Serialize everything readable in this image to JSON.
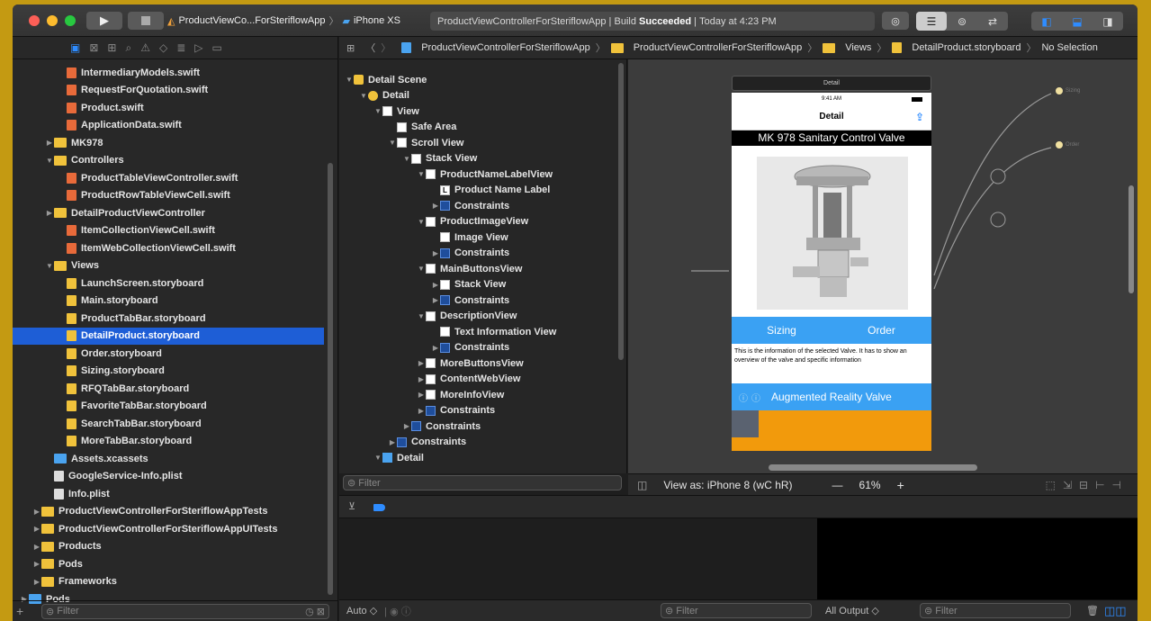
{
  "toolbar": {
    "scheme": "ProductViewCo...ForSteriflowApp",
    "device": "iPhone XS",
    "status_project": "ProductViewControllerForSteriflowApp",
    "status_build": "Build",
    "status_result": "Succeeded",
    "status_time": "Today at 4:23 PM"
  },
  "navigator": {
    "items": [
      {
        "label": "IntermediaryModels.swift",
        "kind": "swift",
        "indent": 2
      },
      {
        "label": "RequestForQuotation.swift",
        "kind": "swift",
        "indent": 2
      },
      {
        "label": "Product.swift",
        "kind": "swift",
        "indent": 2
      },
      {
        "label": "ApplicationData.swift",
        "kind": "swift",
        "indent": 2
      },
      {
        "label": "MK978",
        "kind": "folder",
        "indent": 1,
        "disclosure": "closed"
      },
      {
        "label": "Controllers",
        "kind": "folder",
        "indent": 1,
        "disclosure": "open"
      },
      {
        "label": "ProductTableViewController.swift",
        "kind": "swift",
        "indent": 2
      },
      {
        "label": "ProductRowTableViewCell.swift",
        "kind": "swift",
        "indent": 2
      },
      {
        "label": "DetailProductViewController",
        "kind": "folder",
        "indent": 1,
        "disclosure": "closed"
      },
      {
        "label": "ItemCollectionViewCell.swift",
        "kind": "swift",
        "indent": 2
      },
      {
        "label": "ItemWebCollectionViewCell.swift",
        "kind": "swift",
        "indent": 2
      },
      {
        "label": "Views",
        "kind": "folder",
        "indent": 1,
        "disclosure": "open"
      },
      {
        "label": "LaunchScreen.storyboard",
        "kind": "sb",
        "indent": 2
      },
      {
        "label": "Main.storyboard",
        "kind": "sb",
        "indent": 2
      },
      {
        "label": "ProductTabBar.storyboard",
        "kind": "sb",
        "indent": 2
      },
      {
        "label": "DetailProduct.storyboard",
        "kind": "sb",
        "indent": 2,
        "selected": true
      },
      {
        "label": "Order.storyboard",
        "kind": "sb",
        "indent": 2
      },
      {
        "label": "Sizing.storyboard",
        "kind": "sb",
        "indent": 2
      },
      {
        "label": "RFQTabBar.storyboard",
        "kind": "sb",
        "indent": 2
      },
      {
        "label": "FavoriteTabBar.storyboard",
        "kind": "sb",
        "indent": 2
      },
      {
        "label": "SearchTabBar.storyboard",
        "kind": "sb",
        "indent": 2
      },
      {
        "label": "MoreTabBar.storyboard",
        "kind": "sb",
        "indent": 2
      },
      {
        "label": "Assets.xcassets",
        "kind": "blue",
        "indent": 1
      },
      {
        "label": "GoogleService-Info.plist",
        "kind": "plist",
        "indent": 1
      },
      {
        "label": "Info.plist",
        "kind": "plist",
        "indent": 1
      },
      {
        "label": "ProductViewControllerForSteriflowAppTests",
        "kind": "folder",
        "indent": 0,
        "disclosure": "closed"
      },
      {
        "label": "ProductViewControllerForSteriflowAppUITests",
        "kind": "folder",
        "indent": 0,
        "disclosure": "closed"
      },
      {
        "label": "Products",
        "kind": "folder",
        "indent": 0,
        "disclosure": "closed"
      },
      {
        "label": "Pods",
        "kind": "folder",
        "indent": 0,
        "disclosure": "closed"
      },
      {
        "label": "Frameworks",
        "kind": "folder",
        "indent": 0,
        "disclosure": "closed"
      },
      {
        "label": "Pods",
        "kind": "blue",
        "indent": -1,
        "disclosure": "closed"
      }
    ],
    "filter_placeholder": "Filter"
  },
  "jumpbar": {
    "project": "ProductViewControllerForSteriflowApp",
    "group": "ProductViewControllerForSteriflowApp",
    "folder": "Views",
    "file": "DetailProduct.storyboard",
    "selection": "No Selection"
  },
  "outline": {
    "items": [
      {
        "label": "Detail Scene",
        "icon": "scene",
        "indent": 0,
        "disclosure": "open"
      },
      {
        "label": "Detail",
        "icon": "vc",
        "indent": 1,
        "disclosure": "open"
      },
      {
        "label": "View",
        "icon": "view",
        "indent": 2,
        "disclosure": "open"
      },
      {
        "label": "Safe Area",
        "icon": "view",
        "indent": 3
      },
      {
        "label": "Scroll View",
        "icon": "view",
        "indent": 3,
        "disclosure": "open"
      },
      {
        "label": "Stack View",
        "icon": "stack",
        "indent": 4,
        "disclosure": "open"
      },
      {
        "label": "ProductNameLabelView",
        "icon": "view",
        "indent": 5,
        "disclosure": "open"
      },
      {
        "label": "Product Name Label",
        "icon": "label",
        "indent": 6
      },
      {
        "label": "Constraints",
        "icon": "constraint",
        "indent": 6,
        "disclosure": "closed"
      },
      {
        "label": "ProductImageView",
        "icon": "view",
        "indent": 5,
        "disclosure": "open"
      },
      {
        "label": "Image View",
        "icon": "view",
        "indent": 6
      },
      {
        "label": "Constraints",
        "icon": "constraint",
        "indent": 6,
        "disclosure": "closed"
      },
      {
        "label": "MainButtonsView",
        "icon": "view",
        "indent": 5,
        "disclosure": "open"
      },
      {
        "label": "Stack View",
        "icon": "stack",
        "indent": 6,
        "disclosure": "closed"
      },
      {
        "label": "Constraints",
        "icon": "constraint",
        "indent": 6,
        "disclosure": "closed"
      },
      {
        "label": "DescriptionView",
        "icon": "view",
        "indent": 5,
        "disclosure": "open"
      },
      {
        "label": "Text Information View",
        "icon": "view",
        "indent": 6
      },
      {
        "label": "Constraints",
        "icon": "constraint",
        "indent": 6,
        "disclosure": "closed"
      },
      {
        "label": "MoreButtonsView",
        "icon": "view",
        "indent": 5,
        "disclosure": "closed"
      },
      {
        "label": "ContentWebView",
        "icon": "view",
        "indent": 5,
        "disclosure": "closed"
      },
      {
        "label": "MoreInfoView",
        "icon": "view",
        "indent": 5,
        "disclosure": "closed"
      },
      {
        "label": "Constraints",
        "icon": "constraint",
        "indent": 5,
        "disclosure": "closed"
      },
      {
        "label": "Constraints",
        "icon": "constraint",
        "indent": 4,
        "disclosure": "closed"
      },
      {
        "label": "Constraints",
        "icon": "constraint",
        "indent": 3,
        "disclosure": "closed"
      },
      {
        "label": "Detail",
        "icon": "nav",
        "indent": 2,
        "disclosure": "open"
      }
    ],
    "filter_placeholder": "Filter"
  },
  "canvas": {
    "scene_title": "Detail",
    "status_time": "9:41 AM",
    "nav_title": "Detail",
    "product_name": "MK 978 Sanitary Control Valve",
    "btn_sizing": "Sizing",
    "btn_order": "Order",
    "description": "This is the information of the selected Valve. It has to show an overview of the valve and specific information",
    "ar_label": "Augmented Reality Valve",
    "segue_sizing": "Sizing",
    "segue_order": "Order",
    "view_as": "View as: iPhone 8",
    "size_class": "(wC hR)",
    "zoom": "61%"
  },
  "bottom": {
    "auto": "Auto",
    "filter_left": "Filter",
    "output": "All Output",
    "filter_right": "Filter"
  },
  "colors": {
    "accent": "#2e8cff",
    "selection": "#1e5ed6",
    "button_blue": "#3aa1f3",
    "orange": "#f29a0c"
  }
}
